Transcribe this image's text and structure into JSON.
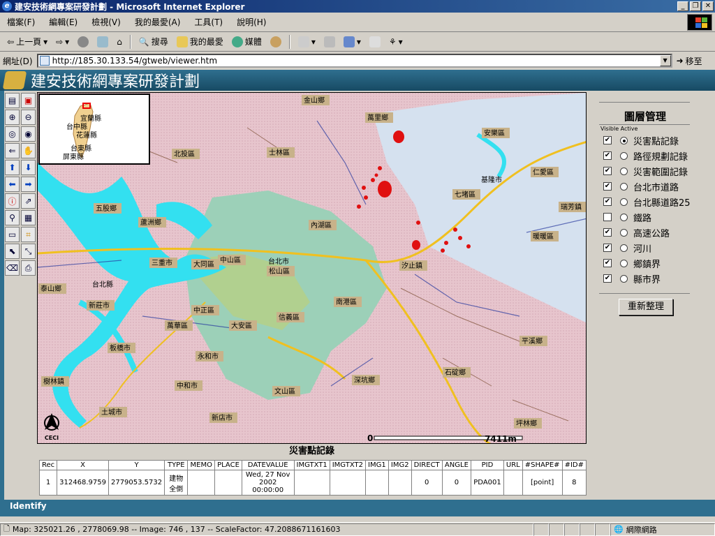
{
  "window": {
    "title": "建安技術網專案研發計劃 - Microsoft Internet Explorer"
  },
  "menu": [
    "檔案(F)",
    "編輯(E)",
    "檢視(V)",
    "我的最愛(A)",
    "工具(T)",
    "說明(H)"
  ],
  "toolbar": {
    "back": "上一頁",
    "search": "搜尋",
    "favorites": "我的最愛",
    "media": "媒體"
  },
  "address": {
    "label": "網址(D)",
    "url": "http://185.30.133.54/gtweb/viewer.htm",
    "go": "移至"
  },
  "banner": {
    "title": "建安技術網專案研發計劃"
  },
  "overview": {
    "labels": [
      "宜蘭縣",
      "台中縣",
      "花蓮縣",
      "台東縣",
      "屏東縣"
    ]
  },
  "map": {
    "districts": [
      "金山鄉",
      "萬里鄉",
      "北投區",
      "士林區",
      "安樂區",
      "仁愛區",
      "基隆市",
      "七堵區",
      "瑞芳鎮",
      "五股鄉",
      "蘆洲鄉",
      "內湖區",
      "暖暖區",
      "三重市",
      "大同區",
      "中山區",
      "台北市",
      "松山區",
      "汐止鎮",
      "泰山鄉",
      "台北縣",
      "新莊市",
      "南港區",
      "中正區",
      "萬華區",
      "大安區",
      "信義區",
      "平溪鄉",
      "板橋市",
      "永和市",
      "深坑鄉",
      "石碇鄉",
      "樹林鎮",
      "中和市",
      "文山區",
      "土城市",
      "新店市",
      "坪林鄉"
    ],
    "scale_text": "7411m",
    "scale_zero": "0",
    "north_label": "CECI"
  },
  "layers": {
    "title": "圖層管理",
    "header": "Visible Active",
    "items": [
      {
        "name": "災害點記錄",
        "visible": true,
        "active": true
      },
      {
        "name": "路徑規劃記錄",
        "visible": true,
        "active": false
      },
      {
        "name": "災害範圍記錄",
        "visible": true,
        "active": false
      },
      {
        "name": "台北市道路",
        "visible": true,
        "active": false
      },
      {
        "name": "台北縣道路25",
        "visible": true,
        "active": false
      },
      {
        "name": "鐵路",
        "visible": false,
        "active": false
      },
      {
        "name": "高速公路",
        "visible": true,
        "active": false
      },
      {
        "name": "河川",
        "visible": true,
        "active": false
      },
      {
        "name": "鄉鎮界",
        "visible": true,
        "active": false
      },
      {
        "name": "縣市界",
        "visible": true,
        "active": false
      }
    ],
    "refresh": "重新整理"
  },
  "results": {
    "title": "災害點記錄",
    "headers": [
      "Rec",
      "X",
      "Y",
      "TYPE",
      "MEMO",
      "PLACE",
      "DATEVALUE",
      "IMGTXT1",
      "IMGTXT2",
      "IMG1",
      "IMG2",
      "DIRECT",
      "ANGLE",
      "PID",
      "URL",
      "#SHAPE#",
      "#ID#"
    ],
    "rows": [
      [
        "1",
        "312468.9759",
        "2779053.5732",
        "建物全倒",
        "",
        "",
        "Wed, 27 Nov 2002 00:00:00",
        "",
        "",
        "",
        "",
        "0",
        "0",
        "PDA001",
        "",
        "[point]",
        "8"
      ]
    ]
  },
  "identify": "Identify",
  "status": {
    "text": "Map: 325021.26 , 2778069.98 -- Image: 746 , 137 -- ScaleFactor: 47.2088671161603",
    "zone": "網際網路"
  },
  "colors": {
    "banner": "#2f6f8f",
    "city": "#8fd4b8",
    "keelung": "#d8e4f0",
    "river": "#33e0f0",
    "highway": "#f0c020",
    "hazard": "#e01010"
  }
}
